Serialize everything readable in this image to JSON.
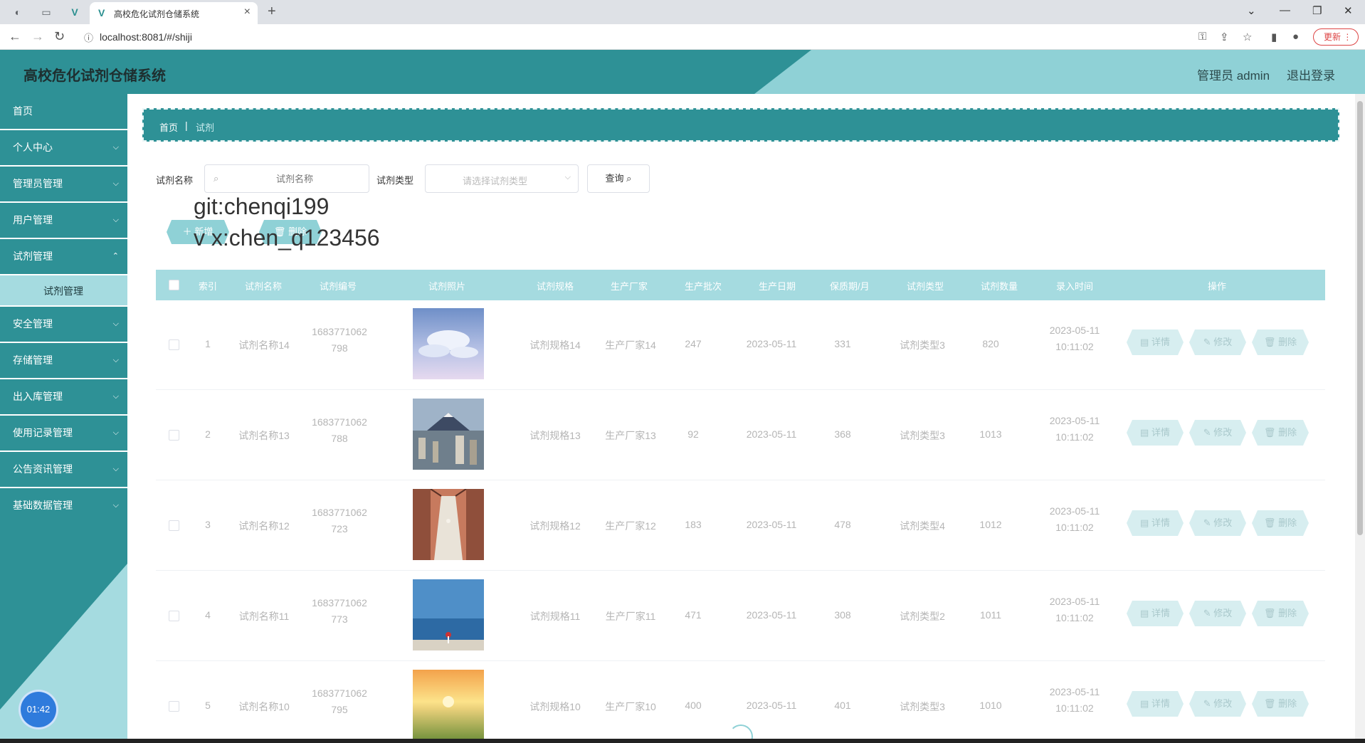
{
  "browser": {
    "tab_title": "高校危化试剂仓储系统",
    "url": "localhost:8081/#/shiji",
    "update_label": "更新"
  },
  "header": {
    "title": "高校危化试剂仓储系统",
    "admin": "管理员 admin",
    "logout": "退出登录"
  },
  "sidebar": {
    "items": [
      {
        "label": "首页"
      },
      {
        "label": "个人中心"
      },
      {
        "label": "管理员管理"
      },
      {
        "label": "用户管理"
      },
      {
        "label": "试剂管理"
      },
      {
        "label": "试剂管理"
      },
      {
        "label": "安全管理"
      },
      {
        "label": "存储管理"
      },
      {
        "label": "出入库管理"
      },
      {
        "label": "使用记录管理"
      },
      {
        "label": "公告资讯管理"
      },
      {
        "label": "基础数据管理"
      }
    ],
    "timer": "01:42"
  },
  "breadcrumb": {
    "home": "首页",
    "sep": "|",
    "current": "试剂"
  },
  "search": {
    "name_label": "试剂名称",
    "name_placeholder": "试剂名称",
    "type_label": "试剂类型",
    "type_placeholder": "请选择试剂类型",
    "query": "查询"
  },
  "actions": {
    "add": "新增",
    "delete": "删除"
  },
  "watermark": {
    "line1": "git:chenqi199",
    "line2": "v x:chen_q123456"
  },
  "table": {
    "headers": [
      "索引",
      "试剂名称",
      "试剂编号",
      "试剂照片",
      "试剂规格",
      "生产厂家",
      "生产批次",
      "生产日期",
      "保质期/月",
      "试剂类型",
      "试剂数量",
      "录入时间",
      "操作"
    ],
    "row_actions": {
      "detail": "详情",
      "edit": "修改",
      "delete": "删除"
    },
    "rows": [
      {
        "index": "1",
        "name": "试剂名称14",
        "code1": "1683771062",
        "code2": "798",
        "spec": "试剂规格14",
        "maker": "生产厂家14",
        "batch": "247",
        "date": "2023-05-11",
        "shelf": "331",
        "type": "试剂类型3",
        "qty": "820",
        "time1": "2023-05-11",
        "time2": "10:11:02",
        "photo": "sky"
      },
      {
        "index": "2",
        "name": "试剂名称13",
        "code1": "1683771062",
        "code2": "788",
        "spec": "试剂规格13",
        "maker": "生产厂家13",
        "batch": "92",
        "date": "2023-05-11",
        "shelf": "368",
        "type": "试剂类型3",
        "qty": "1013",
        "time1": "2023-05-11",
        "time2": "10:11:02",
        "photo": "city-mountain"
      },
      {
        "index": "3",
        "name": "试剂名称12",
        "code1": "1683771062",
        "code2": "723",
        "spec": "试剂规格12",
        "maker": "生产厂家12",
        "batch": "183",
        "date": "2023-05-11",
        "shelf": "478",
        "type": "试剂类型4",
        "qty": "1012",
        "time1": "2023-05-11",
        "time2": "10:11:02",
        "photo": "corridor"
      },
      {
        "index": "4",
        "name": "试剂名称11",
        "code1": "1683771062",
        "code2": "773",
        "spec": "试剂规格11",
        "maker": "生产厂家11",
        "batch": "471",
        "date": "2023-05-11",
        "shelf": "308",
        "type": "试剂类型2",
        "qty": "1011",
        "time1": "2023-05-11",
        "time2": "10:11:02",
        "photo": "sea"
      },
      {
        "index": "5",
        "name": "试剂名称10",
        "code1": "1683771062",
        "code2": "795",
        "spec": "试剂规格10",
        "maker": "生产厂家10",
        "batch": "400",
        "date": "2023-05-11",
        "shelf": "401",
        "type": "试剂类型3",
        "qty": "1010",
        "time1": "2023-05-11",
        "time2": "10:11:02",
        "photo": "sunset-field"
      }
    ]
  },
  "colors": {
    "primary": "#2e9196",
    "light": "#a5dbe0",
    "accent": "#8fd1d6"
  }
}
